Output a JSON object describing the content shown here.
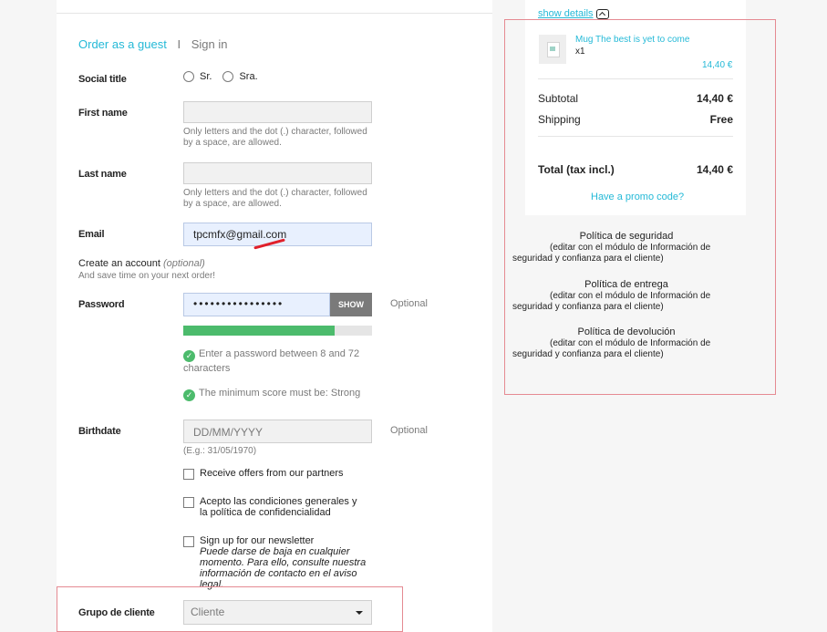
{
  "tabs": {
    "guest": "Order as a guest",
    "separator": "I",
    "signin": "Sign in"
  },
  "form": {
    "social_title": {
      "label": "Social title",
      "options": [
        "Sr.",
        "Sra."
      ]
    },
    "first_name": {
      "label": "First name",
      "value": "",
      "help": "Only letters and the dot (.) character, followed by a space, are allowed."
    },
    "last_name": {
      "label": "Last name",
      "value": "",
      "help": "Only letters and the dot (.) character, followed by a space, are allowed."
    },
    "email": {
      "label": "Email",
      "value": "tpcmfx@gmail.com"
    },
    "create_account": {
      "title": "Create an account",
      "optional": "(optional)",
      "subtitle": "And save time on your next order!"
    },
    "password": {
      "label": "Password",
      "value": "••••••••••••••••",
      "show_label": "SHOW",
      "optional": "Optional",
      "strength_fraction": 0.8,
      "rule1": "Enter a password between 8 and 72 characters",
      "rule2": "The minimum score must be: Strong"
    },
    "birthdate": {
      "label": "Birthdate",
      "placeholder": "DD/MM/YYYY",
      "example": "(E.g.: 31/05/1970)",
      "optional": "Optional"
    },
    "checkboxes": {
      "partners": "Receive offers from our partners",
      "terms": "Acepto las condiciones generales y la política de confidencialidad",
      "newsletter": "Sign up for our newsletter",
      "newsletter_note": "Puede darse de baja en cualquier momento. Para ello, consulte nuestra información de contacto en el aviso legal."
    },
    "customer_group": {
      "label": "Grupo de cliente",
      "value": "Cliente"
    }
  },
  "summary": {
    "show_details": "show details",
    "product": {
      "name": "Mug The best is yet to come",
      "qty": "x1",
      "price": "14,40 €"
    },
    "subtotal_label": "Subtotal",
    "subtotal_value": "14,40 €",
    "shipping_label": "Shipping",
    "shipping_value": "Free",
    "total_label": "Total (tax incl.)",
    "total_value": "14,40 €",
    "promo": "Have a promo code?"
  },
  "reassurance": [
    {
      "title": "Política de seguridad",
      "line1": "(editar con el módulo de Información de",
      "line2": "seguridad y confianza para el cliente)"
    },
    {
      "title": "Política de entrega",
      "line1": "(editar con el módulo de Información de",
      "line2": "seguridad y confianza para el cliente)"
    },
    {
      "title": "Política de devolución",
      "line1": "(editar con el módulo de Información de",
      "line2": "seguridad y confianza para el cliente)"
    }
  ],
  "colors": {
    "accent": "#24b9d7",
    "success": "#4cbb6c",
    "highlight": "#e58a92",
    "underline": "#e0202b"
  }
}
